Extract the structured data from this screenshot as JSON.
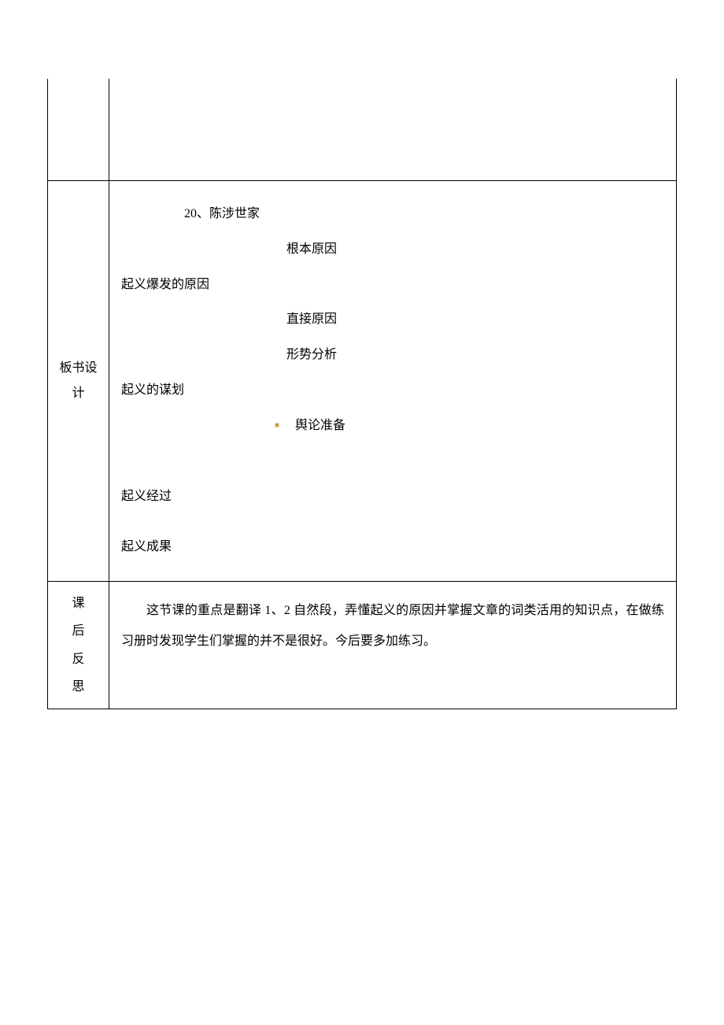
{
  "row1": {
    "left": ""
  },
  "row2": {
    "left_line1": "板书设",
    "left_line2": "计",
    "title": "20、陈涉世家",
    "cause_root": "根本原因",
    "cause_main": "起义爆发的原因",
    "cause_direct": "直接原因",
    "analysis": "形势分析",
    "plan_main": "起义的谋划",
    "opinion_prep": "舆论准备",
    "process": "起义经过",
    "result": "起义成果"
  },
  "row3": {
    "left_c1": "课",
    "left_c2": "后",
    "left_c3": "反",
    "left_c4": "思",
    "content": "这节课的重点是翻译 1、2 自然段，弄懂起义的原因并掌握文章的词类活用的知识点，在做练习册时发现学生们掌握的并不是很好。今后要多加练习。"
  }
}
